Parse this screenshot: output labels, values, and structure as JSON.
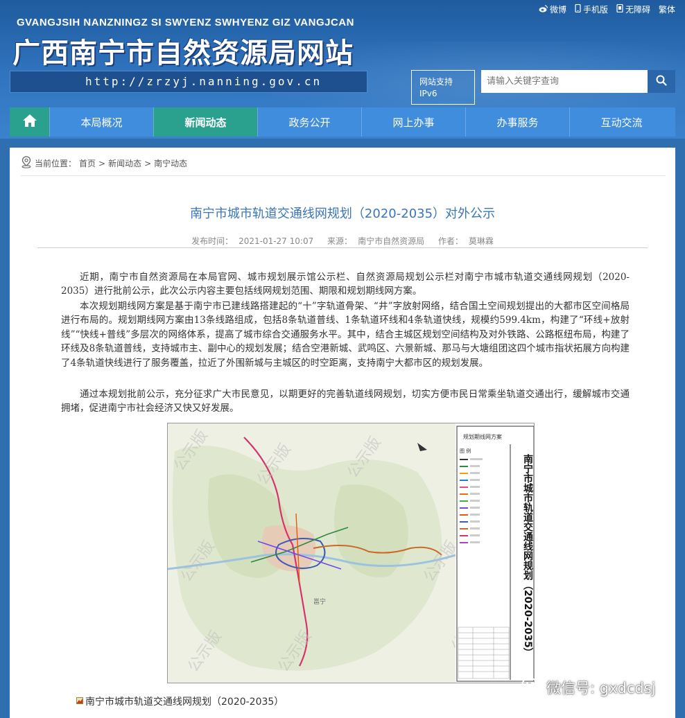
{
  "header": {
    "top_links": [
      {
        "icon": "weibo-icon",
        "label": "微博"
      },
      {
        "icon": "mobile-icon",
        "label": "手机版"
      },
      {
        "icon": "accessibility-icon",
        "label": "无障碍"
      },
      {
        "icon": "",
        "label": "繁体"
      }
    ],
    "zhuang_title": "GVANGJSIH NANZNINGZ SI SWYENZ SWHYENZ GIZ VANGJCAN",
    "site_title": "广西南宁市自然资源局网站",
    "url": "http://zrzyj.nanning.gov.cn",
    "ipv6_line1": "网站支持",
    "ipv6_line2": "IPv6",
    "search_placeholder": "请输入关键字查询"
  },
  "nav": {
    "items": [
      "本局概况",
      "新闻动态",
      "政务公开",
      "网上办事",
      "办事服务",
      "互动交流"
    ],
    "active": "新闻动态"
  },
  "breadcrumb": {
    "prefix": "当前位置：",
    "items": [
      "首页",
      "新闻动态",
      "南宁动态"
    ],
    "separator": ">"
  },
  "article": {
    "title": "南宁市城市轨道交通线网规划（2020-2035）对外公示",
    "published_label": "发布时间：",
    "published": "2021-01-27 10:07",
    "source_label": "来源：",
    "source": "南宁市自然资源局",
    "author_label": "作者：",
    "author": "莫琳霖",
    "paragraphs": [
      "近期，南宁市自然资源局在本局官网、城市规划展示馆公示栏、自然资源局规划公示栏对南宁市城市轨道交通线网规划（2020-2035）进行批前公示，此次公示内容主要包括线网规划范围、期限和规划期线网方案。",
      "本次规划期线网方案是基于南宁市已建线路搭建起的“十”字轨道骨架、“井”字放射网络，结合国土空间规划提出的大都市区空间格局进行布局的。规划期线网方案由13条线路组成，包括8条轨道普线、1条轨道环线和4条轨道快线，规模约599.4km，构建了“环线+放射线”“快线+普线”多层次的网络体系，提高了城市综合交通服务水平。其中，结合主城区规划空间结构及对外铁路、公路枢纽布局，构建了环线及8条轨道普线，支持城市主、副中心的规划发展；结合空港新城、武鸣区、六景新城、那马与大塘组团这四个城市指状拓展方向构建了4条轨道快线进行了服务覆盖，拉近了外围新城与主城区的时空距离，支持南宁大都市区的规划发展。",
      "通过本规划批前公示，充分征求广大市民意见，以期更好的完善轨道线网规划，切实方便市民日常乘坐轨道交通出行，缓解城市交通拥堵，促进南宁市社会经济又快又好发展。"
    ]
  },
  "map_image": {
    "vertical_title": "南宁市城市轨道交通线网规划（2020-2035）",
    "legend_title": "规划期线网方案",
    "legend_header": "图 例",
    "watermark": "公示版",
    "place_label": "邕宁"
  },
  "caption": "南宁市城市轨道交通线网规划（2020-2035）",
  "wechat_watermark": "微信号: gxdcdsj",
  "colors": {
    "header_blue": "#2f73bd",
    "nav_blue": "#3f8ddc",
    "nav_active": "#2aa18e",
    "title_blue": "#3a75b7"
  }
}
